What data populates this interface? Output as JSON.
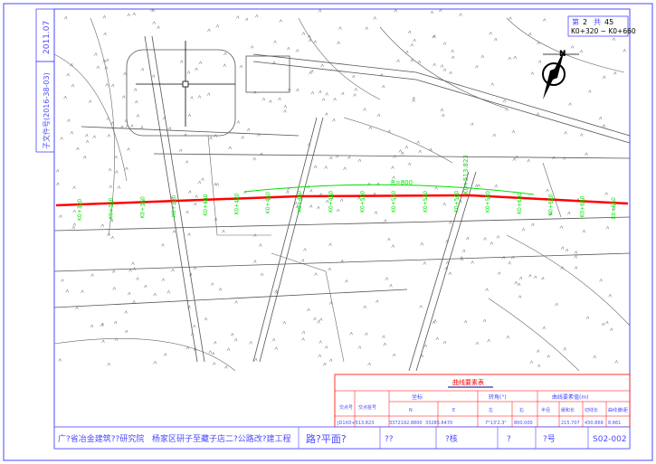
{
  "sheet": {
    "number_prefix": "第",
    "sheet_no": "2",
    "sheet_total_prefix": "共",
    "sheet_total": "45",
    "chainage_range": "K0+320 ~ K0+660"
  },
  "side_strip": {
    "date": "2011.07",
    "drawing_id": "子文件号(2016-38-03)"
  },
  "title_block": {
    "org": "广?省冶金建筑??研究院",
    "project": "杨家区研子至藏子店二?公路改?建工程",
    "drawing_title": "路?平面?",
    "design": "??",
    "review": "?核",
    "approve": "?",
    "number_label": "?号",
    "number": "S02-002"
  },
  "curve_table": {
    "title": "曲线要素表",
    "headers": [
      "交点号",
      "交点桩号",
      "N",
      "E",
      "左",
      "右",
      "半径",
      "缓和长",
      "切线长",
      "曲线长",
      "外距"
    ],
    "group_headers": [
      "坐标",
      "转角(°)",
      "曲线要素值(m)"
    ],
    "row": [
      "JD1",
      "K0+513.823",
      "3372192.8800",
      "33285.6470",
      "",
      "7°13'2.3\"",
      "800.000",
      "",
      "215.707",
      "430.869",
      "8.861"
    ]
  },
  "road_labels": [
    "K0+320",
    "K0+340",
    "K0+360",
    "K0+380",
    "K0+400",
    "K0+420",
    "K0+440",
    "K0+460",
    "K0+480",
    "K0+500",
    "K0+520",
    "K0+540",
    "K0+560",
    "K0+580",
    "K0+600",
    "K0+620",
    "K0+640",
    "K0+660"
  ],
  "curve_label": "R=800",
  "cross_road_label": "K0+513.823",
  "colors": {
    "frame": "#4a4aff",
    "road": "#ff0000",
    "green": "#00e000",
    "title_red": "#ff0000",
    "map_line": "#555555"
  }
}
